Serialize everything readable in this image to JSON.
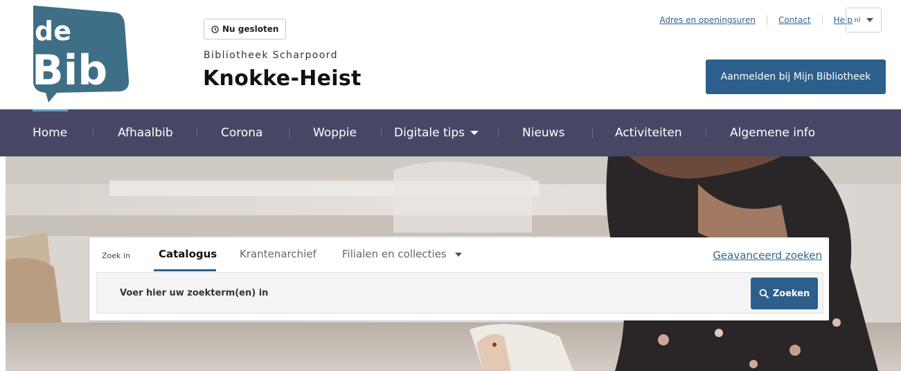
{
  "header": {
    "logo": {
      "line1": "de",
      "line2": "Bib"
    },
    "status_label": "Nu gesloten",
    "library_subtitle": "Bibliotheek Scharpoord",
    "library_title": "Knokke-Heist",
    "links": [
      {
        "label": "Adres en openingsuren"
      },
      {
        "label": "Contact"
      },
      {
        "label": "Help"
      }
    ],
    "language": "nl",
    "login_label": "Aanmelden bij Mijn Bibliotheek"
  },
  "nav": {
    "items": [
      {
        "label": "Home"
      },
      {
        "label": "Afhaalbib"
      },
      {
        "label": "Corona"
      },
      {
        "label": "Woppie"
      },
      {
        "label": "Digitale tips"
      },
      {
        "label": "Nieuws"
      },
      {
        "label": "Activiteiten"
      },
      {
        "label": "Algemene info"
      }
    ]
  },
  "search": {
    "zoek_in_label": "Zoek in",
    "tabs": [
      {
        "label": "Catalogus"
      },
      {
        "label": "Krantenarchief"
      },
      {
        "label": "Filialen en collecties"
      }
    ],
    "advanced_label": "Geavanceerd zoeken",
    "placeholder": "Voer hier uw zoekterm(en) in",
    "button_label": "Zoeken"
  },
  "colors": {
    "brand_blue": "#2c5f8b",
    "nav_bg": "#474765",
    "logo_blue": "#3f6f86"
  }
}
